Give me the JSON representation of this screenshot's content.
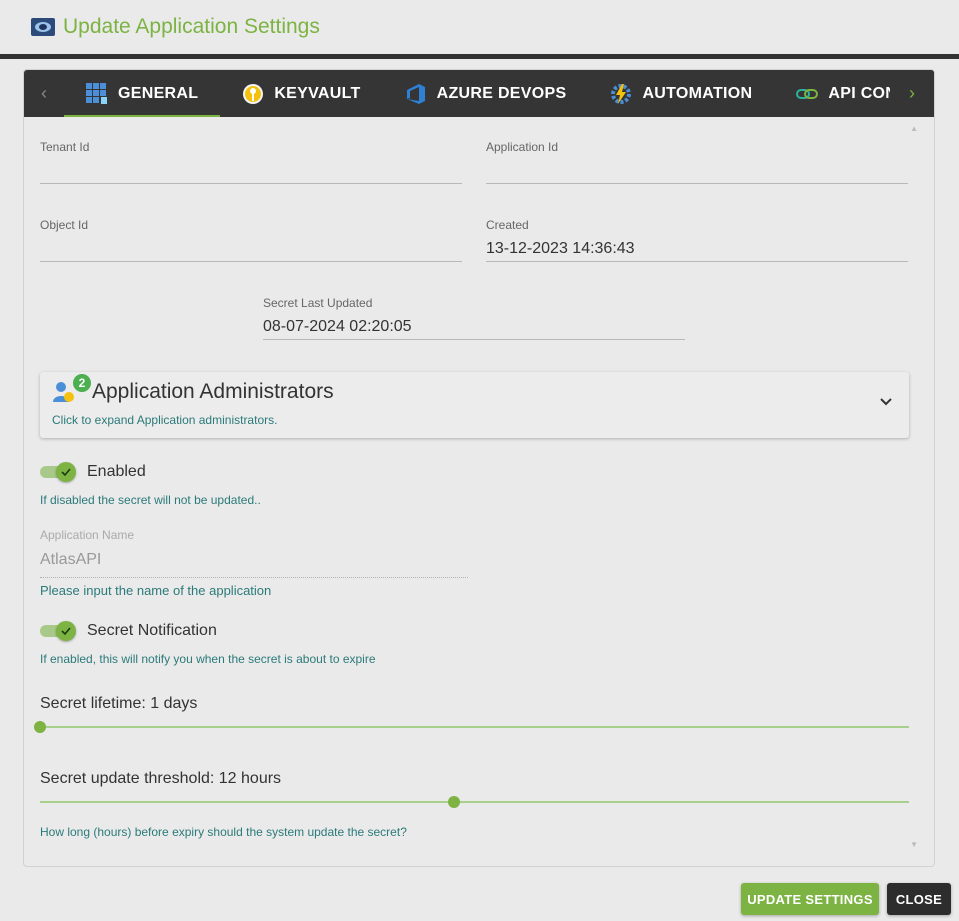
{
  "dialog": {
    "title": "Update Application Settings",
    "accent_color": "#7cb342"
  },
  "tabs": [
    {
      "label": "GENERAL",
      "icon": "grid-icon",
      "active": true
    },
    {
      "label": "KEYVAULT",
      "icon": "key-icon",
      "active": false
    },
    {
      "label": "AZURE DEVOPS",
      "icon": "azure-devops-icon",
      "active": false
    },
    {
      "label": "AUTOMATION",
      "icon": "automation-icon",
      "active": false
    },
    {
      "label": "API CON",
      "icon": "link-icon",
      "active": false
    }
  ],
  "fields": {
    "tenant_id": {
      "label": "Tenant Id",
      "value": ""
    },
    "application_id": {
      "label": "Application Id",
      "value": ""
    },
    "object_id": {
      "label": "Object Id",
      "value": ""
    },
    "created": {
      "label": "Created",
      "value": "13-12-2023 14:36:43"
    },
    "secret_last_updated": {
      "label": "Secret Last Updated",
      "value": "08-07-2024 02:20:05"
    }
  },
  "admins": {
    "title": "Application Administrators",
    "subtitle": "Click to expand Application administrators.",
    "count": "2"
  },
  "enabled": {
    "label": "Enabled",
    "hint": "If disabled the secret will not be updated..",
    "checked": true
  },
  "application_name": {
    "label": "Application Name",
    "value": "AtlasAPI",
    "hint": "Please input the name of the application"
  },
  "secret_notification": {
    "label": "Secret Notification",
    "hint": "If enabled, this will notify you when the secret is about to expire",
    "checked": true
  },
  "secret_lifetime": {
    "label": "Secret lifetime: 1 days",
    "fraction": 0.0
  },
  "secret_threshold": {
    "label": "Secret update threshold: 12 hours",
    "hint": "How long (hours) before expiry should the system update the secret?",
    "fraction": 0.476
  },
  "buttons": {
    "update": "UPDATE SETTINGS",
    "close": "CLOSE"
  }
}
